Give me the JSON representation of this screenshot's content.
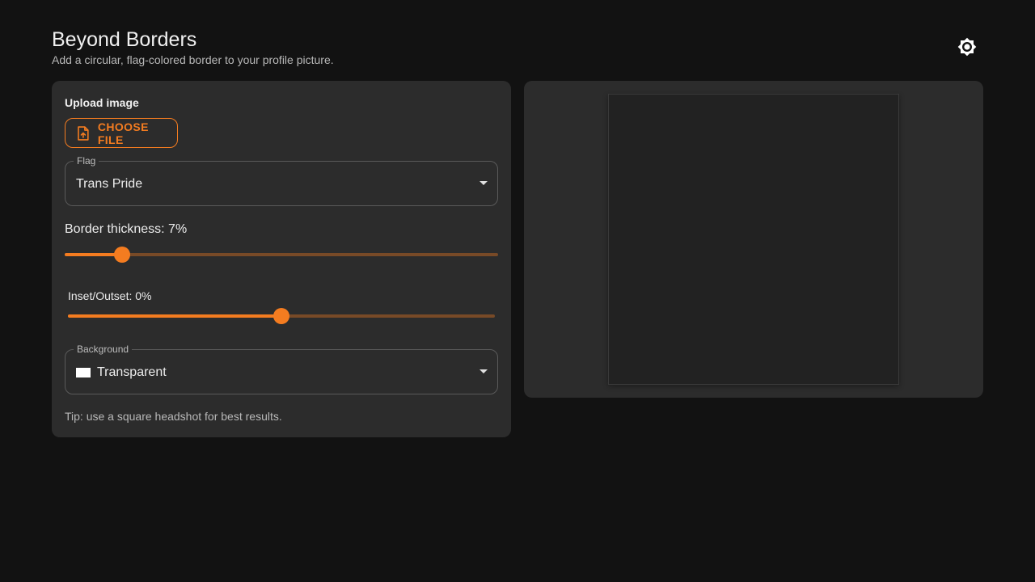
{
  "header": {
    "title": "Beyond Borders",
    "subtitle": "Add a circular, flag-colored border to your profile picture."
  },
  "theme_toggle": {
    "icon": "brightness-icon"
  },
  "controls": {
    "upload_label": "Upload image",
    "choose_file": "CHOOSE FILE",
    "flag": {
      "legend": "Flag",
      "value": "Trans Pride"
    },
    "thickness": {
      "label": "Border thickness: 7%",
      "value_fraction": 0.133
    },
    "inset": {
      "label": "Inset/Outset: 0%",
      "value_fraction": 0.5
    },
    "background": {
      "legend": "Background",
      "value": "Transparent",
      "swatch_color": "#ffffff"
    },
    "tip": "Tip: use a square headshot for best results."
  },
  "colors": {
    "accent": "#f47c20",
    "background": "#121212",
    "panel": "#2c2c2c"
  }
}
